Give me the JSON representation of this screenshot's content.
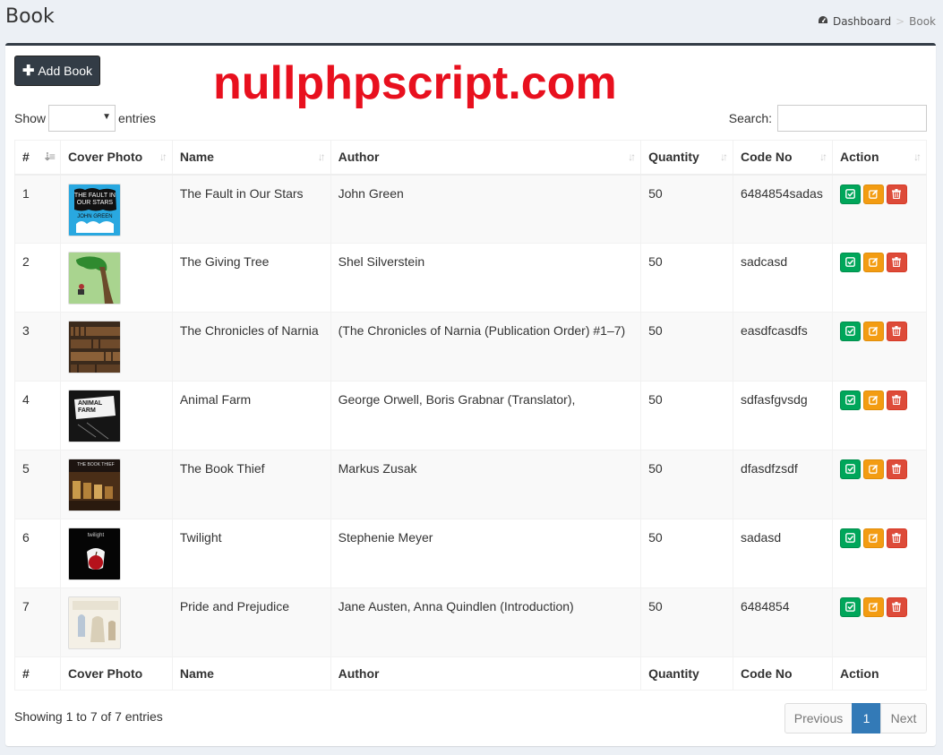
{
  "header": {
    "title": "Book"
  },
  "breadcrumb": {
    "home": "Dashboard",
    "current": "Book",
    "separator": ">"
  },
  "toolbar": {
    "add_label": "Add Book"
  },
  "watermark": "nullphpscript.com",
  "length": {
    "show_label": "Show",
    "entries_label": "entries",
    "selected": ""
  },
  "search": {
    "label": "Search:",
    "value": ""
  },
  "table": {
    "columns": [
      "#",
      "Cover Photo",
      "Name",
      "Author",
      "Quantity",
      "Code No",
      "Action"
    ],
    "rows": [
      {
        "num": "1",
        "name": "The Fault in Our Stars",
        "author": "John Green",
        "qty": "50",
        "code": "6484854sadas",
        "cover": "fault-in-our-stars-cover",
        "cover_text_1": "THE FAULT IN OUR STARS",
        "cover_text_2": "JOHN GREEN"
      },
      {
        "num": "2",
        "name": "The Giving Tree",
        "author": "Shel Silverstein",
        "qty": "50",
        "code": "sadcasd",
        "cover": "giving-tree-cover"
      },
      {
        "num": "3",
        "name": "The Chronicles of Narnia",
        "author": "(The Chronicles of Narnia (Publication Order) #1–7)",
        "qty": "50",
        "code": "easdfcasdfs",
        "cover": "bookshelf-cover"
      },
      {
        "num": "4",
        "name": "Animal Farm",
        "author": "George Orwell, Boris Grabnar (Translator),",
        "qty": "50",
        "code": "sdfasfgvsdg",
        "cover": "animal-farm-cover",
        "cover_text_1": "ANIMAL FARM"
      },
      {
        "num": "5",
        "name": "The Book Thief",
        "author": "Markus Zusak",
        "qty": "50",
        "code": "dfasdfzsdf",
        "cover": "book-thief-cover",
        "cover_text_1": "THE BOOK THIEF"
      },
      {
        "num": "6",
        "name": "Twilight",
        "author": "Stephenie Meyer",
        "qty": "50",
        "code": "sadasd",
        "cover": "twilight-cover",
        "cover_text_1": "twilight"
      },
      {
        "num": "7",
        "name": "Pride and Prejudice",
        "author": "Jane Austen, Anna Quindlen (Introduction)",
        "qty": "50",
        "code": "6484854",
        "cover": "pride-prejudice-cover"
      }
    ]
  },
  "info": "Showing 1 to 7 of 7 entries",
  "pagination": {
    "previous": "Previous",
    "current": "1",
    "next": "Next"
  },
  "colors": {
    "primary_dark": "#333c46",
    "success": "#00a65a",
    "warning": "#f39c12",
    "danger": "#dd4b39",
    "watermark": "#e8101e",
    "page_active": "#337ab7"
  }
}
